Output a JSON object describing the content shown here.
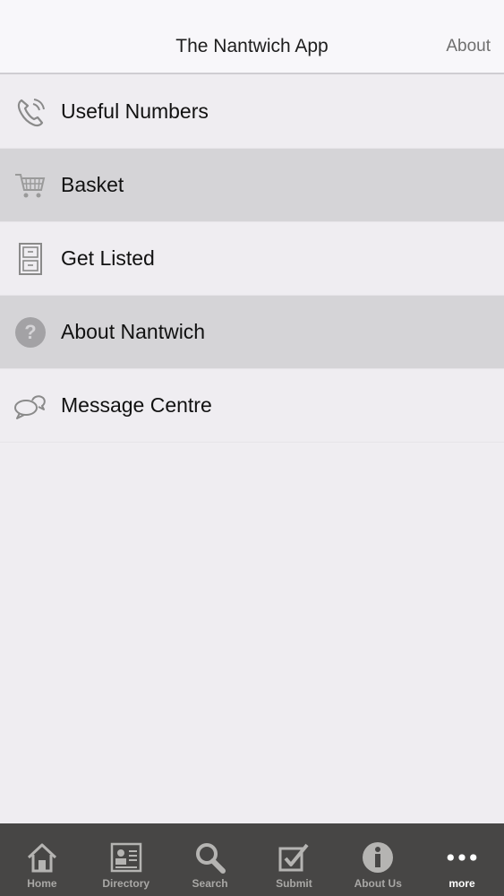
{
  "header": {
    "title": "The Nantwich App",
    "about_label": "About"
  },
  "menu": {
    "items": [
      {
        "label": "Useful Numbers",
        "icon": "phone-icon"
      },
      {
        "label": "Basket",
        "icon": "cart-icon"
      },
      {
        "label": "Get Listed",
        "icon": "cabinet-icon"
      },
      {
        "label": "About Nantwich",
        "icon": "question-icon"
      },
      {
        "label": "Message Centre",
        "icon": "chat-icon"
      }
    ]
  },
  "tabbar": {
    "tabs": [
      {
        "label": "Home",
        "icon": "home-icon"
      },
      {
        "label": "Directory",
        "icon": "directory-icon"
      },
      {
        "label": "Search",
        "icon": "search-icon"
      },
      {
        "label": "Submit",
        "icon": "submit-icon"
      },
      {
        "label": "About Us",
        "icon": "info-icon"
      },
      {
        "label": "more",
        "icon": "more-icon",
        "active": true
      }
    ]
  },
  "colors": {
    "background": "#efedf1",
    "row_highlight": "#d5d4d7",
    "tabbar": "#474645",
    "tab_label": "#a9a8a6",
    "tab_label_active": "#ffffff"
  }
}
